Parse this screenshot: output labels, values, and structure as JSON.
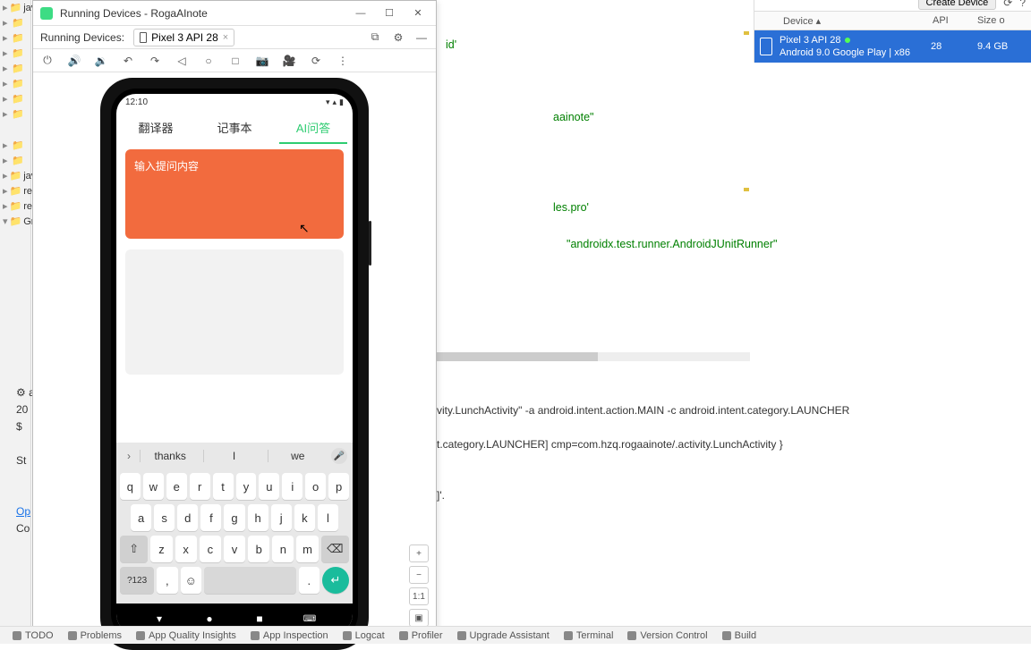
{
  "proj_tree": {
    "nodes": [
      "jav",
      " ",
      " ",
      " ",
      " ",
      " ",
      " ",
      " ",
      " ",
      "jav",
      "res",
      "res",
      "Gradle"
    ]
  },
  "rd_window": {
    "title": "Running Devices - RogaAInote",
    "bar_label": "Running Devices:",
    "tab_name": "Pixel 3 API 28"
  },
  "phone": {
    "status_time": "12:10",
    "tabs": [
      "翻译器",
      "记事本",
      "AI问答"
    ],
    "active_tab_index": 2,
    "orange_placeholder": "输入提问内容",
    "suggestions": [
      "thanks",
      "I",
      "we"
    ],
    "kb_row1": [
      "q",
      "w",
      "e",
      "r",
      "t",
      "y",
      "u",
      "i",
      "o",
      "p"
    ],
    "kb_row2": [
      "a",
      "s",
      "d",
      "f",
      "g",
      "h",
      "j",
      "k",
      "l"
    ],
    "kb_row3": [
      "z",
      "x",
      "c",
      "v",
      "b",
      "n",
      "m"
    ],
    "key_123": "?123",
    "key_comma": ",",
    "key_dot": "."
  },
  "zoom": {
    "one_to_one": "1:1"
  },
  "code": {
    "l1": "id'",
    "l2": "aainote\"",
    "l3": "les.pro'",
    "l4": "\"androidx.test.runner.AndroidJUnitRunner\""
  },
  "term": {
    "app_val": "ap",
    "t20": "20",
    "dollar": "$",
    "st": "St",
    "op": "Op",
    "co": "Co",
    "line1": "vity.LunchActivity\" -a android.intent.action.MAIN -c android.intent.category.LAUNCHER",
    "line2": "t.category.LAUNCHER] cmp=com.hzq.rogaainote/.activity.LunchActivity }",
    "line3": "]'."
  },
  "bottom": {
    "items": [
      "TODO",
      "Problems",
      "App Quality Insights",
      "App Inspection",
      "Logcat",
      "Profiler",
      "Upgrade Assistant",
      "Terminal",
      "Version Control",
      "Build"
    ]
  },
  "dm": {
    "create": "Create Device",
    "col_device": "Device",
    "col_api": "API",
    "col_size": "Size o",
    "row_name": "Pixel 3 API 28",
    "row_sub": "Android 9.0 Google Play | x86",
    "row_api": "28",
    "row_size": "9.4 GB"
  }
}
